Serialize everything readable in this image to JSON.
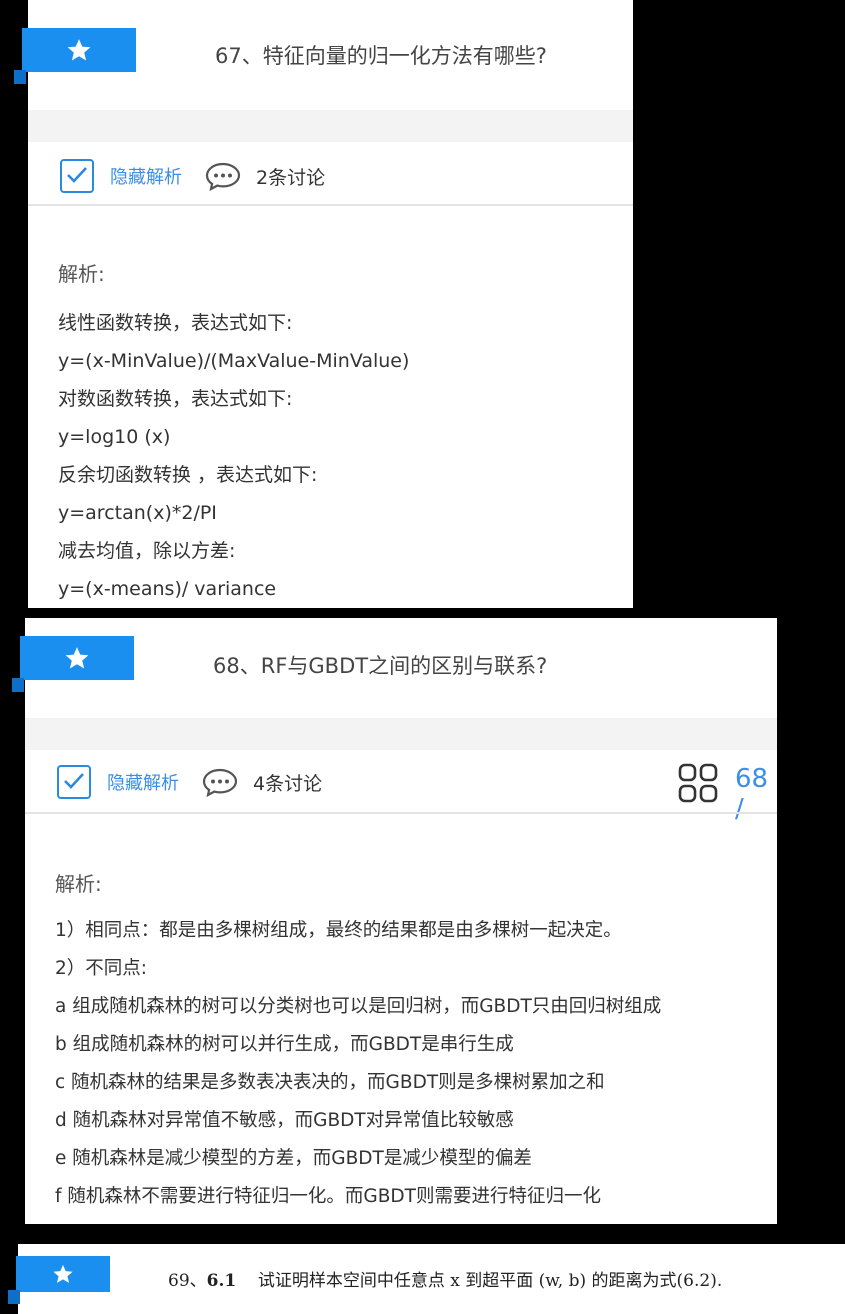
{
  "q67": {
    "title": "67、特征向量的归一化方法有哪些?",
    "hide_label": "隐藏解析",
    "discussion": "2条讨论",
    "analysis_label": "解析:",
    "lines": [
      "线性函数转换，表达式如下:",
      "y=(x-MinValue)/(MaxValue-MinValue)",
      "对数函数转换，表达式如下:",
      "y=log10 (x)",
      "反余切函数转换 ，表达式如下:",
      "y=arctan(x)*2/PI",
      "减去均值，除以方差:",
      "y=(x-means)/ variance"
    ]
  },
  "q68": {
    "title": "68、RF与GBDT之间的区别与联系?",
    "hide_label": "隐藏解析",
    "discussion": "4条讨论",
    "counter": "68 /",
    "analysis_label": "解析:",
    "lines": [
      "1）相同点：都是由多棵树组成，最终的结果都是由多棵树一起决定。",
      "2）不同点:",
      "a 组成随机森林的树可以分类树也可以是回归树，而GBDT只由回归树组成",
      "b 组成随机森林的树可以并行生成，而GBDT是串行生成",
      "c 随机森林的结果是多数表决表决的，而GBDT则是多棵树累加之和",
      "d 随机森林对异常值不敏感，而GBDT对异常值比较敏感",
      "e 随机森林是减少模型的方差，而GBDT是减少模型的偏差",
      "f 随机森林不需要进行特征归一化。而GBDT则需要进行特征归一化"
    ]
  },
  "q69": {
    "num": "69、",
    "bold": "6.1",
    "text": "试证明样本空间中任意点 x 到超平面 (w, b) 的距离为式(6.2)."
  },
  "colors": {
    "accent": "#1a8ff0",
    "link": "#3c8ee6"
  }
}
